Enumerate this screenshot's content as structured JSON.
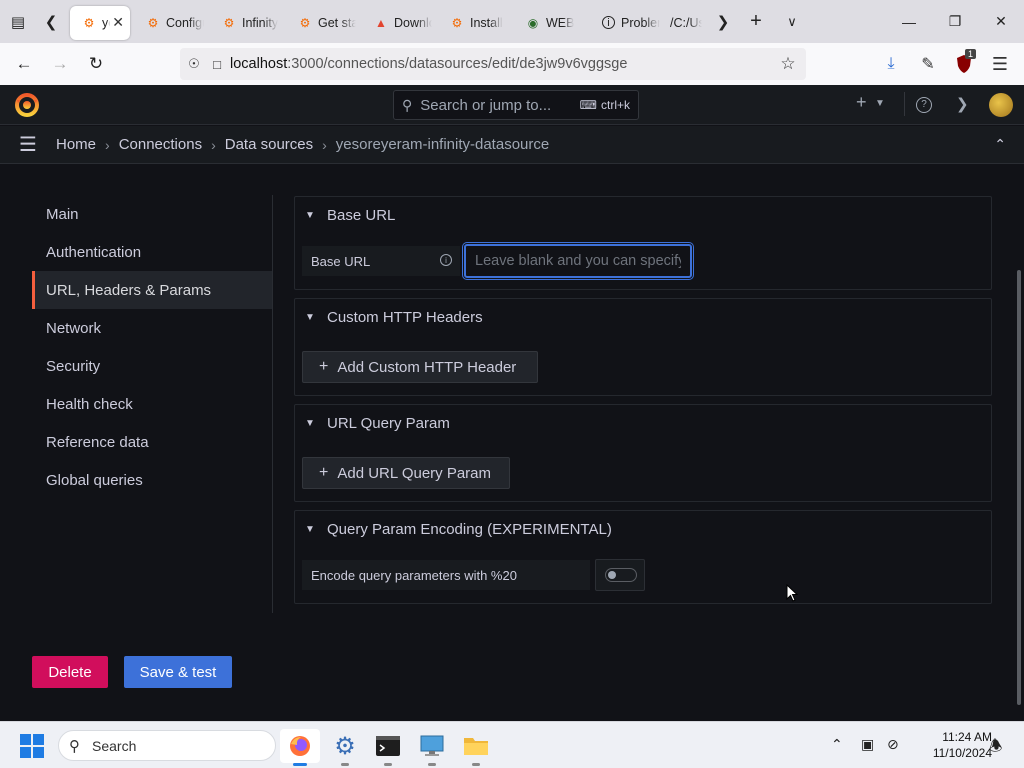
{
  "browser": {
    "tabs": [
      {
        "label": "yesoreyeram",
        "icon": "grafana-icon",
        "active": true
      },
      {
        "label": "Configure",
        "icon": "grafana-icon"
      },
      {
        "label": "Infinity",
        "icon": "grafana-icon"
      },
      {
        "label": "Get started",
        "icon": "grafana-icon"
      },
      {
        "label": "Download",
        "icon": "flame-icon"
      },
      {
        "label": "Install",
        "icon": "grafana-icon"
      },
      {
        "label": "WEB",
        "icon": "eye-icon"
      },
      {
        "label": "Problem",
        "icon": "info-icon"
      },
      {
        "label": "/C:/Users",
        "icon": "none"
      }
    ],
    "url_host": "localhost",
    "url_path": ":3000/connections/datasources/edit/de3jw9v6vggsge",
    "extension_badge": "1"
  },
  "grafana": {
    "search_placeholder": "Search or jump to...",
    "search_shortcut": "ctrl+k",
    "breadcrumbs": [
      "Home",
      "Connections",
      "Data sources",
      "yesoreyeram-infinity-datasource"
    ],
    "sidebar": [
      {
        "label": "Main"
      },
      {
        "label": "Authentication"
      },
      {
        "label": "URL, Headers & Params",
        "active": true
      },
      {
        "label": "Network"
      },
      {
        "label": "Security"
      },
      {
        "label": "Health check"
      },
      {
        "label": "Reference data"
      },
      {
        "label": "Global queries"
      }
    ],
    "sections": {
      "base_url": {
        "title": "Base URL",
        "field_label": "Base URL",
        "input_value": "",
        "input_placeholder": "Leave blank and you can specify full URL in the query"
      },
      "headers": {
        "title": "Custom HTTP Headers",
        "button": "Add Custom HTTP Header"
      },
      "query_params": {
        "title": "URL Query Param",
        "button": "Add URL Query Param"
      },
      "encoding": {
        "title": "Query Param Encoding (EXPERIMENTAL)",
        "field_label": "Encode query parameters with %20",
        "toggle_on": false
      }
    },
    "actions": {
      "delete": "Delete",
      "save": "Save & test"
    },
    "colors": {
      "accent": "#3d71d9",
      "danger": "#d10e5c",
      "active_marker": "#f55f3e"
    }
  },
  "taskbar": {
    "search_label": "Search",
    "time": "11:24 AM",
    "date": "11/10/2024"
  }
}
